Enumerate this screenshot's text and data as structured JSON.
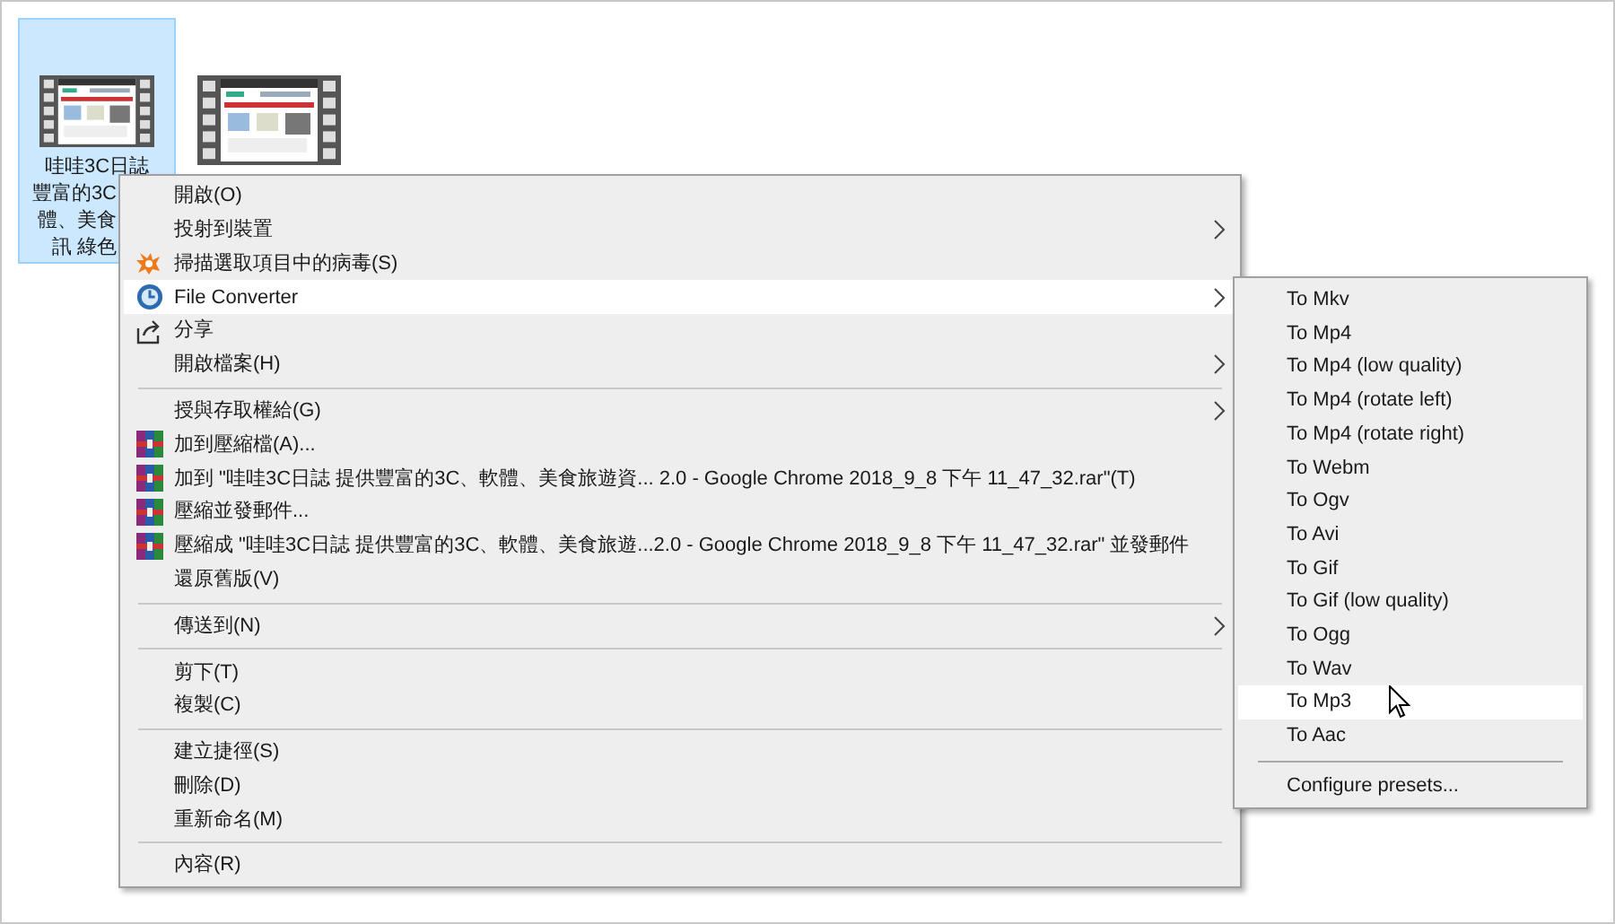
{
  "desktop_items": [
    {
      "kind": "video",
      "selected": true,
      "label_lines": [
        "哇哇3C日誌",
        "豐富的3C",
        "體、美食",
        "訊 綠色"
      ]
    },
    {
      "kind": "video",
      "selected": false
    }
  ],
  "context_menu": {
    "items": [
      {
        "kind": "plain",
        "label": "開啟(O)",
        "submenu": false,
        "selected": false
      },
      {
        "kind": "plain",
        "label": "投射到裝置",
        "submenu": true,
        "selected": false
      },
      {
        "kind": "antivirus",
        "label": "掃描選取項目中的病毒(S)",
        "submenu": false,
        "selected": false
      },
      {
        "kind": "converter",
        "label": "File Converter",
        "submenu": true,
        "selected": true
      },
      {
        "kind": "share",
        "label": "分享",
        "submenu": false,
        "selected": false
      },
      {
        "kind": "plain",
        "label": "開啟檔案(H)",
        "submenu": true,
        "selected": false
      },
      {
        "kind": "separator"
      },
      {
        "kind": "plain",
        "label": "授與存取權給(G)",
        "submenu": true,
        "selected": false
      },
      {
        "kind": "archive",
        "label": "加到壓縮檔(A)...",
        "submenu": false,
        "selected": false
      },
      {
        "kind": "archive",
        "label": "加到 \"哇哇3C日誌 提供豐富的3C、軟體、美食旅遊資... 2.0 - Google Chrome 2018_9_8 下午 11_47_32.rar\"(T)",
        "submenu": false,
        "selected": false
      },
      {
        "kind": "archive",
        "label": "壓縮並發郵件...",
        "submenu": false,
        "selected": false
      },
      {
        "kind": "archive",
        "label": "壓縮成 \"哇哇3C日誌 提供豐富的3C、軟體、美食旅遊...2.0 - Google Chrome 2018_9_8 下午 11_47_32.rar\" 並發郵件",
        "submenu": false,
        "selected": false
      },
      {
        "kind": "plain",
        "label": "還原舊版(V)",
        "submenu": false,
        "selected": false
      },
      {
        "kind": "separator"
      },
      {
        "kind": "plain",
        "label": "傳送到(N)",
        "submenu": true,
        "selected": false
      },
      {
        "kind": "separator"
      },
      {
        "kind": "plain",
        "label": "剪下(T)",
        "submenu": false,
        "selected": false
      },
      {
        "kind": "plain",
        "label": "複製(C)",
        "submenu": false,
        "selected": false
      },
      {
        "kind": "separator"
      },
      {
        "kind": "plain",
        "label": "建立捷徑(S)",
        "submenu": false,
        "selected": false
      },
      {
        "kind": "plain",
        "label": "刪除(D)",
        "submenu": false,
        "selected": false
      },
      {
        "kind": "plain",
        "label": "重新命名(M)",
        "submenu": false,
        "selected": false
      },
      {
        "kind": "separator"
      },
      {
        "kind": "plain",
        "label": "內容(R)",
        "submenu": false,
        "selected": false
      }
    ]
  },
  "submenu": {
    "items": [
      {
        "kind": "item",
        "label": "To Mkv",
        "selected": false
      },
      {
        "kind": "item",
        "label": "To Mp4",
        "selected": false
      },
      {
        "kind": "item",
        "label": "To Mp4 (low quality)",
        "selected": false
      },
      {
        "kind": "item",
        "label": "To Mp4 (rotate left)",
        "selected": false
      },
      {
        "kind": "item",
        "label": "To Mp4 (rotate right)",
        "selected": false
      },
      {
        "kind": "item",
        "label": "To Webm",
        "selected": false
      },
      {
        "kind": "item",
        "label": "To Ogv",
        "selected": false
      },
      {
        "kind": "item",
        "label": "To Avi",
        "selected": false
      },
      {
        "kind": "item",
        "label": "To Gif",
        "selected": false
      },
      {
        "kind": "item",
        "label": "To Gif (low quality)",
        "selected": false
      },
      {
        "kind": "item",
        "label": "To Ogg",
        "selected": false
      },
      {
        "kind": "item",
        "label": "To Wav",
        "selected": false
      },
      {
        "kind": "item",
        "label": "To Mp3",
        "selected": true
      },
      {
        "kind": "item",
        "label": "To Aac",
        "selected": false
      },
      {
        "kind": "separator"
      },
      {
        "kind": "item",
        "label": "Configure presets...",
        "selected": false
      }
    ]
  }
}
